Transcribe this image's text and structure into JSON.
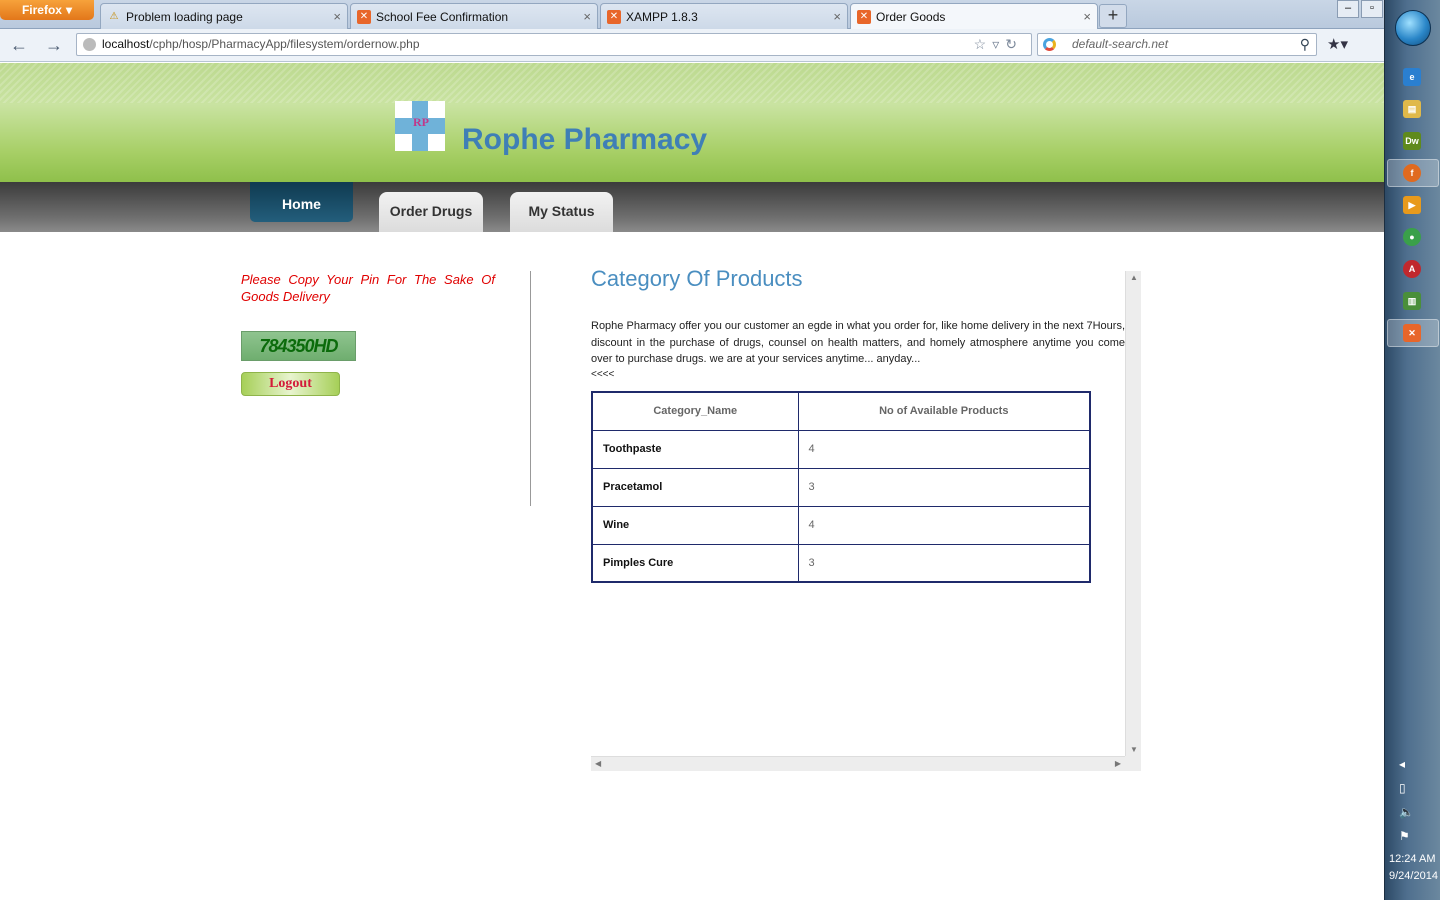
{
  "browser": {
    "app_button": "Firefox",
    "tabs": [
      {
        "title": "Problem loading page",
        "icon": "warning-icon"
      },
      {
        "title": "School Fee Confirmation",
        "icon": "xampp-icon"
      },
      {
        "title": "XAMPP 1.8.3",
        "icon": "xampp-icon"
      },
      {
        "title": "Order Goods",
        "icon": "xampp-icon",
        "active": true
      }
    ],
    "url_host": "localhost",
    "url_path": "/cphp/hosp/PharmacyApp/filesystem/ordernow.php",
    "search_placeholder": "default-search.net"
  },
  "site": {
    "logo_mark": "RP",
    "title": "Rophe Pharmacy",
    "menu": [
      {
        "label": "Home"
      },
      {
        "label": "Order Drugs"
      },
      {
        "label": "My Status"
      }
    ]
  },
  "left": {
    "pin_note": "Please Copy Your Pin For The Sake Of Goods Delivery",
    "pin": "784350HD",
    "logout_label": "Logout"
  },
  "main": {
    "title": "Category Of Products",
    "description": "Rophe Pharmacy offer you our customer an egde in what you order for, like home delivery in the next 7Hours, discount in the purchase of drugs, counsel on health matters, and homely atmosphere anytime you come over to purchase drugs. we are at your services anytime... anyday...",
    "back_arrows": "<<<<",
    "table": {
      "headers": [
        "Category_Name",
        "No of Available Products"
      ],
      "rows": [
        {
          "name": "Toothpaste",
          "count": "4"
        },
        {
          "name": "Pracetamol",
          "count": "3"
        },
        {
          "name": "Wine",
          "count": "4"
        },
        {
          "name": "Pimples Cure",
          "count": "3"
        }
      ]
    }
  },
  "taskbar": {
    "time": "12:24 AM",
    "date": "9/24/2014"
  },
  "colors": {
    "header_green": "#a7cf66",
    "title_blue": "#3f7fb6",
    "pin_note_red": "#e00000",
    "table_border": "#1f2a6b"
  }
}
